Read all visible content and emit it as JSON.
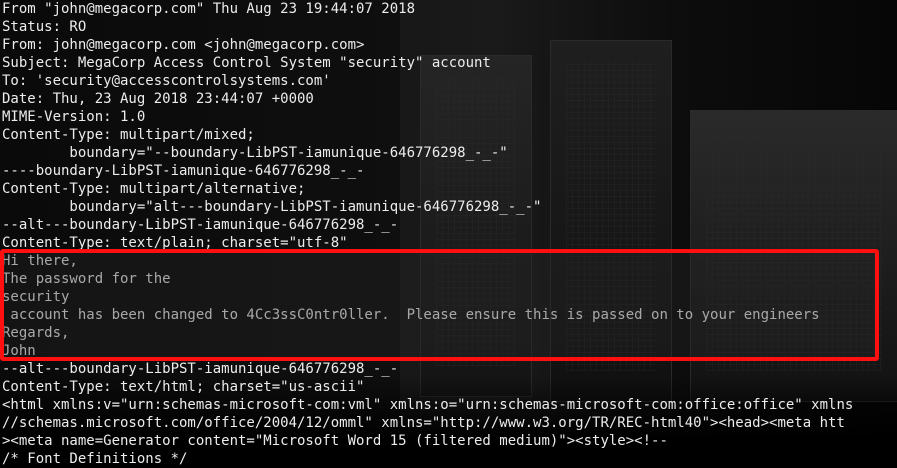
{
  "terminal": {
    "lines": [
      "From \"john@megacorp.com\" Thu Aug 23 19:44:07 2018",
      "Status: RO",
      "From: john@megacorp.com <john@megacorp.com>",
      "Subject: MegaCorp Access Control System \"security\" account",
      "To: 'security@accesscontrolsystems.com'",
      "Date: Thu, 23 Aug 2018 23:44:07 +0000",
      "MIME-Version: 1.0",
      "Content-Type: multipart/mixed;",
      "        boundary=\"--boundary-LibPST-iamunique-646776298_-_-\"",
      "----boundary-LibPST-iamunique-646776298_-_-",
      "Content-Type: multipart/alternative;",
      "        boundary=\"alt---boundary-LibPST-iamunique-646776298_-_-\"",
      "--alt---boundary-LibPST-iamunique-646776298_-_-",
      "Content-Type: text/plain; charset=\"utf-8\"",
      "Hi there,",
      "The password for the",
      "security",
      " account has been changed to 4Cc3ssC0ntr0ller.  Please ensure this is passed on to your engineers",
      "Regards,",
      "John",
      "--alt---boundary-LibPST-iamunique-646776298_-_-",
      "Content-Type: text/html; charset=\"us-ascii\"",
      "<html xmlns:v=\"urn:schemas-microsoft-com:vml\" xmlns:o=\"urn:schemas-microsoft-com:office:office\" xmlns",
      "//schemas.microsoft.com/office/2004/12/omml\" xmlns=\"http://www.w3.org/TR/REC-html40\"><head><meta htt",
      "><meta name=Generator content=\"Microsoft Word 15 (filtered medium)\"><style><!--",
      "/* Font Definitions */"
    ]
  },
  "colors": {
    "text": "#ececec",
    "highlight_border": "#ff1010",
    "background": "#000000"
  }
}
